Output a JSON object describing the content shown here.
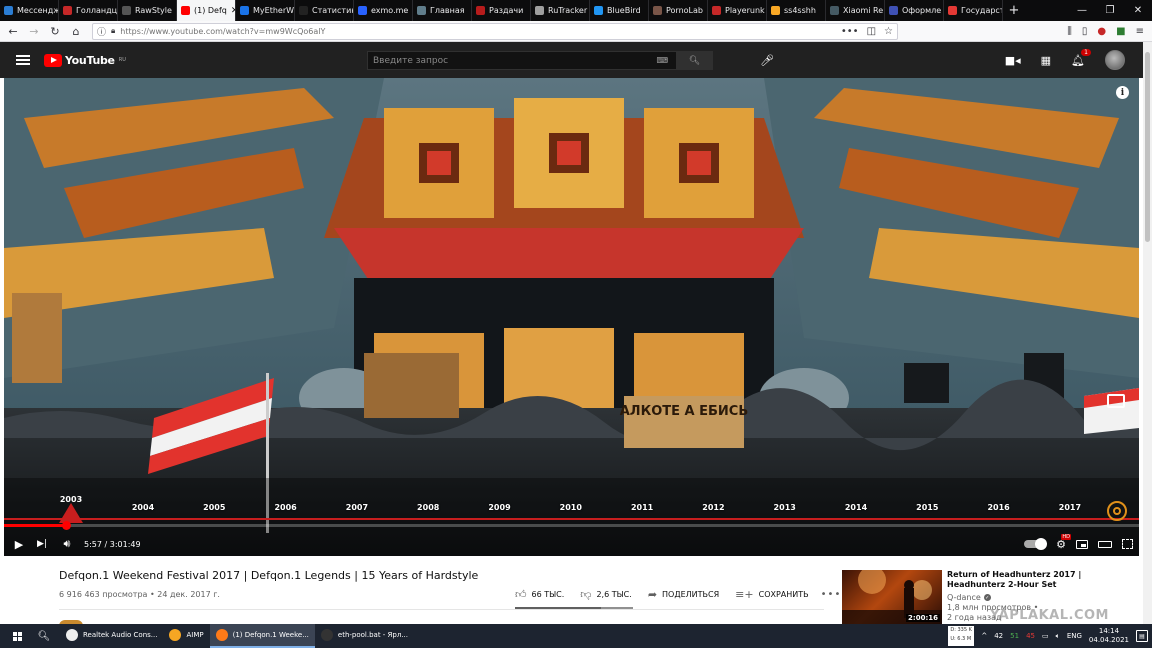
{
  "tabs": [
    {
      "label": "Мессендж",
      "color": "#2b7dd3"
    },
    {
      "label": "Голландц",
      "color": "#c62828"
    },
    {
      "label": "RawStyle",
      "color": "#555555"
    },
    {
      "label": "(1) Defq",
      "color": "#ff0000",
      "active": true
    },
    {
      "label": "MyEtherW",
      "color": "#1a73e8"
    },
    {
      "label": "Статистик",
      "color": "#222222"
    },
    {
      "label": "exmo.me",
      "color": "#2962ff"
    },
    {
      "label": "Главная",
      "color": "#607d8b"
    },
    {
      "label": "Раздачи",
      "color": "#b71c1c"
    },
    {
      "label": "RuTracker",
      "color": "#9e9e9e"
    },
    {
      "label": "BlueBird",
      "color": "#2196f3"
    },
    {
      "label": "PornoLab",
      "color": "#795548"
    },
    {
      "label": "Playerunk",
      "color": "#c62828"
    },
    {
      "label": "ss4sshh",
      "color": "#f9a825"
    },
    {
      "label": "Xiaomi Re",
      "color": "#455a64"
    },
    {
      "label": "Оформле",
      "color": "#3f51b5"
    },
    {
      "label": "Государст",
      "color": "#e53935"
    }
  ],
  "nav": {
    "url": "https://www.youtube.com/watch?v=mw9WcQo6alY"
  },
  "youtube": {
    "logo": "YouTube",
    "region": "RU",
    "search_placeholder": "Введите запрос",
    "notifications": "1"
  },
  "player": {
    "years": [
      "2004",
      "2005",
      "2006",
      "2007",
      "2008",
      "2009",
      "2010",
      "2011",
      "2012",
      "2013",
      "2014",
      "2015",
      "2016",
      "2017"
    ],
    "first_year": "2003",
    "sign_text": "АЛКОТЕ А ЕБИСЬ",
    "time": "5:57 / 3:01:49",
    "progress": 0.0546
  },
  "video": {
    "title": "Defqon.1 Weekend Festival 2017 | Defqon.1 Legends | 15 Years of Hardstyle",
    "meta": "6 916 463 просмотра • 24 дек. 2017 г.",
    "likes": "66 ТЫС.",
    "dislikes": "2,6 ТЫС.",
    "share": "ПОДЕЛИТЬСЯ",
    "save": "СОХРАНИТЬ",
    "more": "•••"
  },
  "recommended": {
    "title": "Return of Headhunterz 2017 | Headhunterz 2-Hour Set",
    "channel": "Q-dance",
    "views": "1,8 млн просмотров •",
    "date": "2 года назад",
    "duration": "2:00:16"
  },
  "watermark": "YAPLAKAL.COM",
  "taskbar": {
    "apps": [
      {
        "label": "Realtek Audio Cons...",
        "color": "#eeeeee"
      },
      {
        "label": "AIMP",
        "color": "#f5a623"
      },
      {
        "label": "(1) Defqon.1 Weeke...",
        "color": "#ff7a18",
        "active": true
      },
      {
        "label": "eth-pool.bat - Ярл...",
        "color": "#333333"
      }
    ],
    "net_down": "D: 335 K",
    "net_up": "U: 6.3 M",
    "tray_a": "42",
    "tray_b": "51",
    "tray_c": "45",
    "lang": "ENG",
    "time": "14:14",
    "date": "04.04.2021"
  }
}
